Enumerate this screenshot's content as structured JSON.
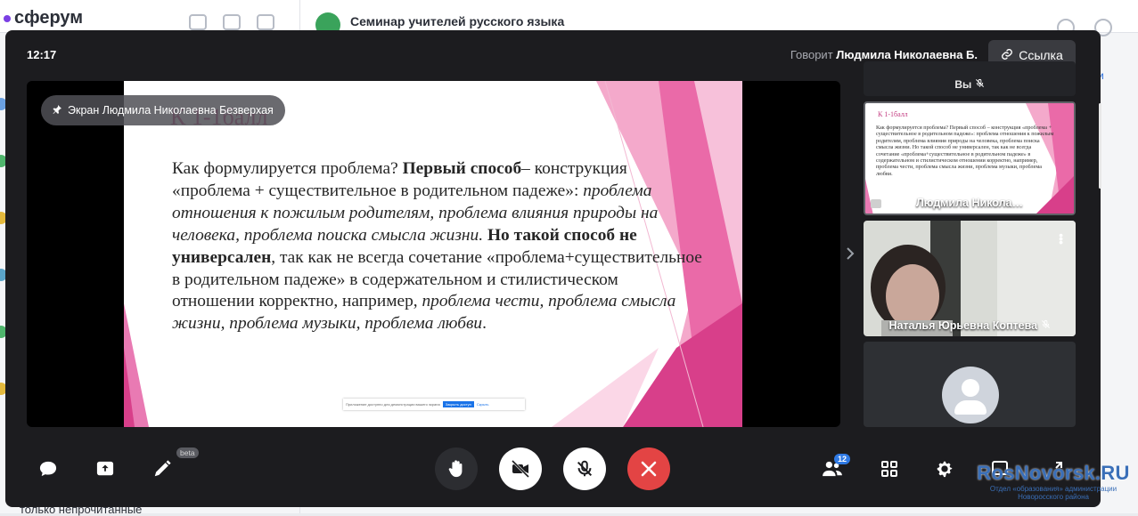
{
  "background": {
    "logo": "сферум",
    "chat_title": "Семинар учителей русского языка",
    "bottom_text": "только непрочитанные",
    "link_fragment": "и"
  },
  "call": {
    "time": "12:17",
    "speaking_prefix": "Говорит",
    "speaking_name": "Людмила Николаевна Б.",
    "link_button": "Ссылка",
    "pin_label": "Экран Людмила Николаевна Безверхая",
    "slide": {
      "title": "К 1-1балл",
      "paragraph": [
        {
          "t": "Как формулируется проблема? ",
          "s": "n"
        },
        {
          "t": "Первый способ",
          "s": "b"
        },
        {
          "t": "– конструкция «проблема + существительное в родительном падеже»: ",
          "s": "n"
        },
        {
          "t": "проблема отношения к пожилым родителям, проблема влияния природы на человека, проблема поиска смысла жизни.",
          "s": "i"
        },
        {
          "t": "  ",
          "s": "n"
        },
        {
          "t": "Но такой способ не универсален",
          "s": "b"
        },
        {
          "t": ", так как не всегда сочетание «проблема+существительное в родительном падеже» в содержательном и стилистическом отношении корректно, например, ",
          "s": "n"
        },
        {
          "t": "проблема чести, проблема смысла жизни,  проблема музыки, проблема любви",
          "s": "i"
        },
        {
          "t": ".",
          "s": "n"
        }
      ],
      "share_bar_text": "Приложение доступно для демонстрации вашего экрана",
      "share_bar_button": "Закрыть доступ",
      "share_bar_link": "Скрыть"
    },
    "participants": [
      {
        "name": "Вы",
        "type": "self"
      },
      {
        "name": "Людмила Никола…",
        "type": "screen"
      },
      {
        "name": "Наталья Юрьевна Коптева",
        "type": "camera"
      },
      {
        "name": "",
        "type": "avatar"
      }
    ],
    "mini_slide_title": "К 1-1балл",
    "mini_slide_text": "Как формулируется проблема? Первый способ – конструкция «проблема + существительное в родительном падеже»: проблема отношения к пожилым родителям, проблема влияния природы на человека, проблема поиска смысла жизни. Но такой способ не универсален, так как не всегда сочетание «проблема+существительное в родительном падеже» в содержательном и стилистическом отношении корректно, например, проблема чести, проблема смысла жизни, проблема музыки, проблема любви.",
    "controls": {
      "beta_badge": "beta",
      "participants_count": "12"
    }
  },
  "watermark": {
    "main": "RosNovorsk.RU",
    "sub_line1": "Отдел «образования» администрации",
    "sub_line2": "Новоросского района"
  },
  "colors": {
    "call_bg": "#1c1c1f",
    "end_call": "#e34444",
    "accent_pink": "#e0529a",
    "badge_blue": "#2f7ae5"
  }
}
